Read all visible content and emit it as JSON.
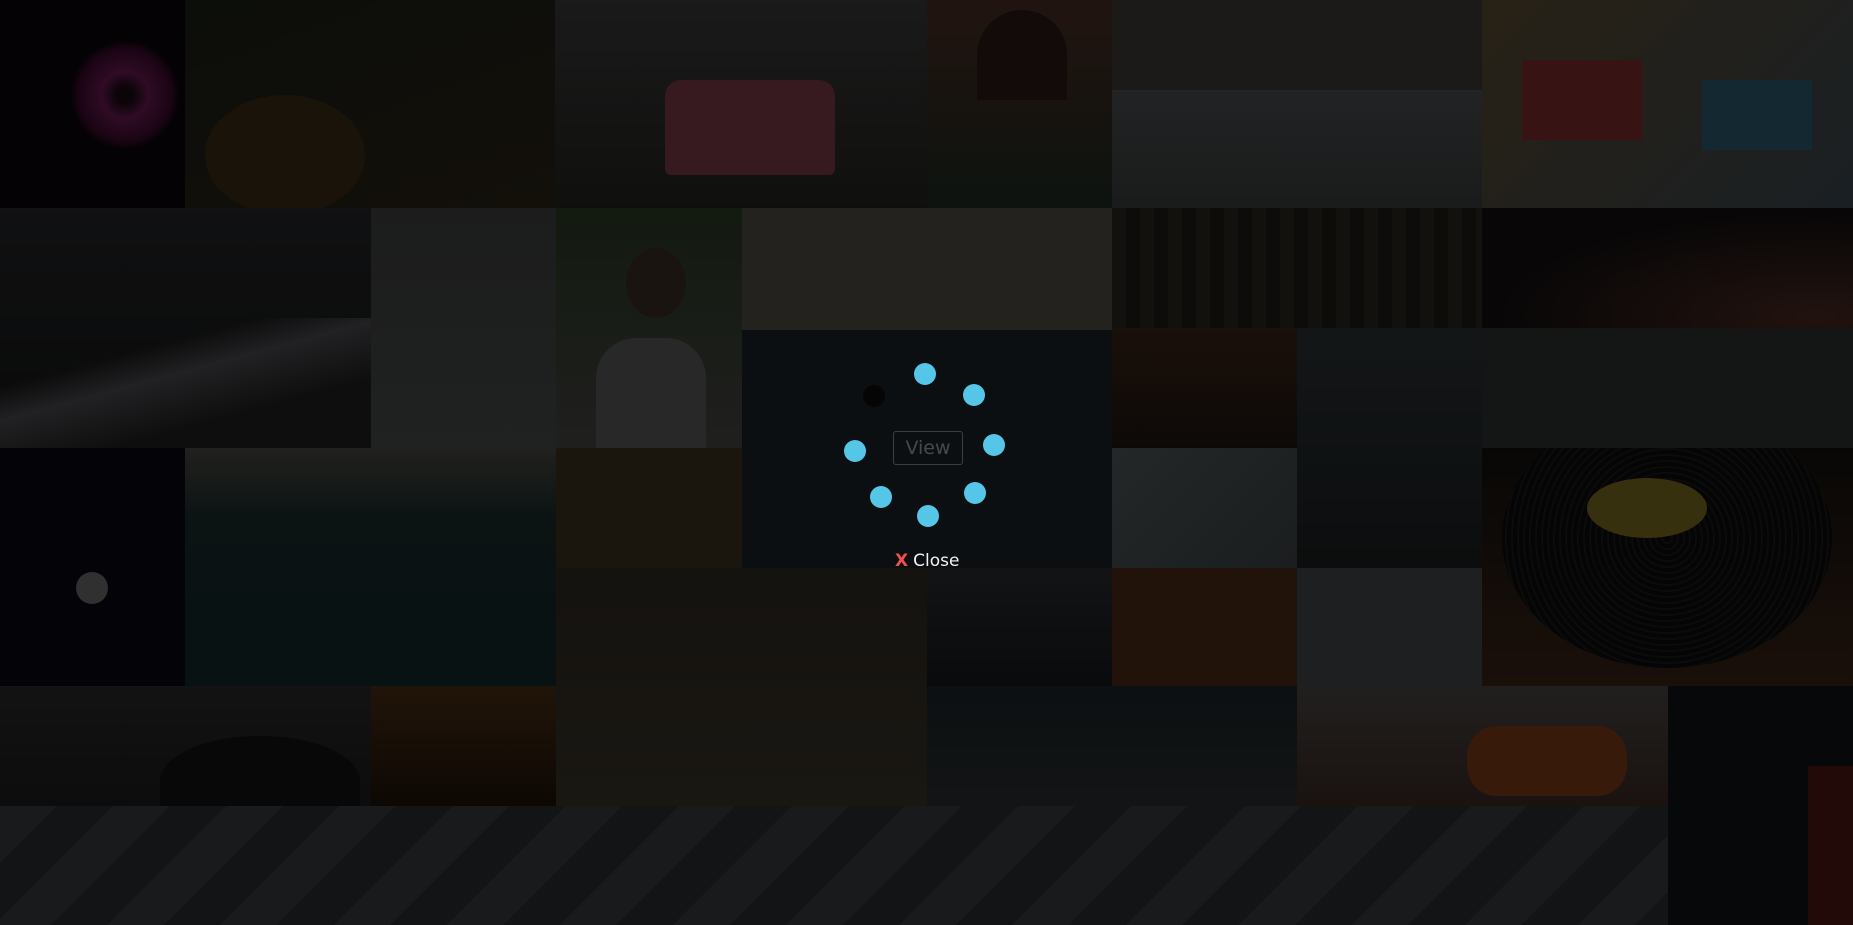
{
  "gallery": {
    "tiles": [
      {
        "name": "gallery-tile-flower",
        "color": "#0a0609"
      },
      {
        "name": "gallery-tile-succulents",
        "color": "#1a1c14"
      },
      {
        "name": "gallery-tile-pink-van",
        "color": "#2a2826"
      },
      {
        "name": "gallery-tile-arch-building",
        "color": "#3a2a24"
      },
      {
        "name": "gallery-tile-hazy-building",
        "color": "#3c3c3a"
      },
      {
        "name": "gallery-tile-beach-huts",
        "color": "#4a3a22"
      },
      {
        "name": "gallery-tile-mountains",
        "color": "#212224"
      },
      {
        "name": "gallery-tile-white-pattern",
        "color": "#3e3f3f"
      },
      {
        "name": "gallery-tile-man-with-cap",
        "color": "#3b3a2c"
      },
      {
        "name": "gallery-tile-food-table",
        "color": "#504a40"
      },
      {
        "name": "gallery-tile-city-night",
        "color": "#272420"
      },
      {
        "name": "gallery-tile-red-curve",
        "color": "#1a1416"
      },
      {
        "name": "gallery-tile-harbor",
        "color": "#43484a"
      },
      {
        "name": "gallery-tile-office",
        "color": "#2a1c16"
      },
      {
        "name": "gallery-tile-grey-sky",
        "color": "#2e2f30"
      },
      {
        "name": "gallery-tile-moon",
        "color": "#0b0a12"
      },
      {
        "name": "gallery-tile-coastline",
        "color": "#142426"
      },
      {
        "name": "gallery-tile-posters-wall",
        "color": "#3a3220"
      },
      {
        "name": "gallery-tile-geometric-white",
        "color": "#4a4e4e"
      },
      {
        "name": "gallery-tile-city-water",
        "color": "#1e2224"
      },
      {
        "name": "gallery-tile-vinyl-record",
        "color": "#16100c"
      },
      {
        "name": "gallery-tile-tiger",
        "color": "#2c2820"
      },
      {
        "name": "gallery-tile-rooftop",
        "color": "#1e2022"
      },
      {
        "name": "gallery-tile-orange-sky",
        "color": "#4a2c18"
      },
      {
        "name": "gallery-tile-zigzag",
        "color": "#3c3c3e"
      },
      {
        "name": "gallery-tile-dark-hill",
        "color": "#242424"
      },
      {
        "name": "gallery-tile-sunset-pier",
        "color": "#4a2a10"
      },
      {
        "name": "gallery-tile-bookshelf",
        "color": "#1c2428"
      },
      {
        "name": "gallery-tile-oranges",
        "color": "#3a302c"
      },
      {
        "name": "gallery-tile-person-red",
        "color": "#0e1216"
      },
      {
        "name": "gallery-tile-bottom-pattern",
        "color": "#2e3234"
      }
    ],
    "view_button_label": "View"
  },
  "lightbox": {
    "close_icon": "X",
    "close_label": "Close",
    "spinner": {
      "icon": "loading-spinner-icon",
      "accent": "#55c6e8",
      "dark": "#050505"
    }
  }
}
